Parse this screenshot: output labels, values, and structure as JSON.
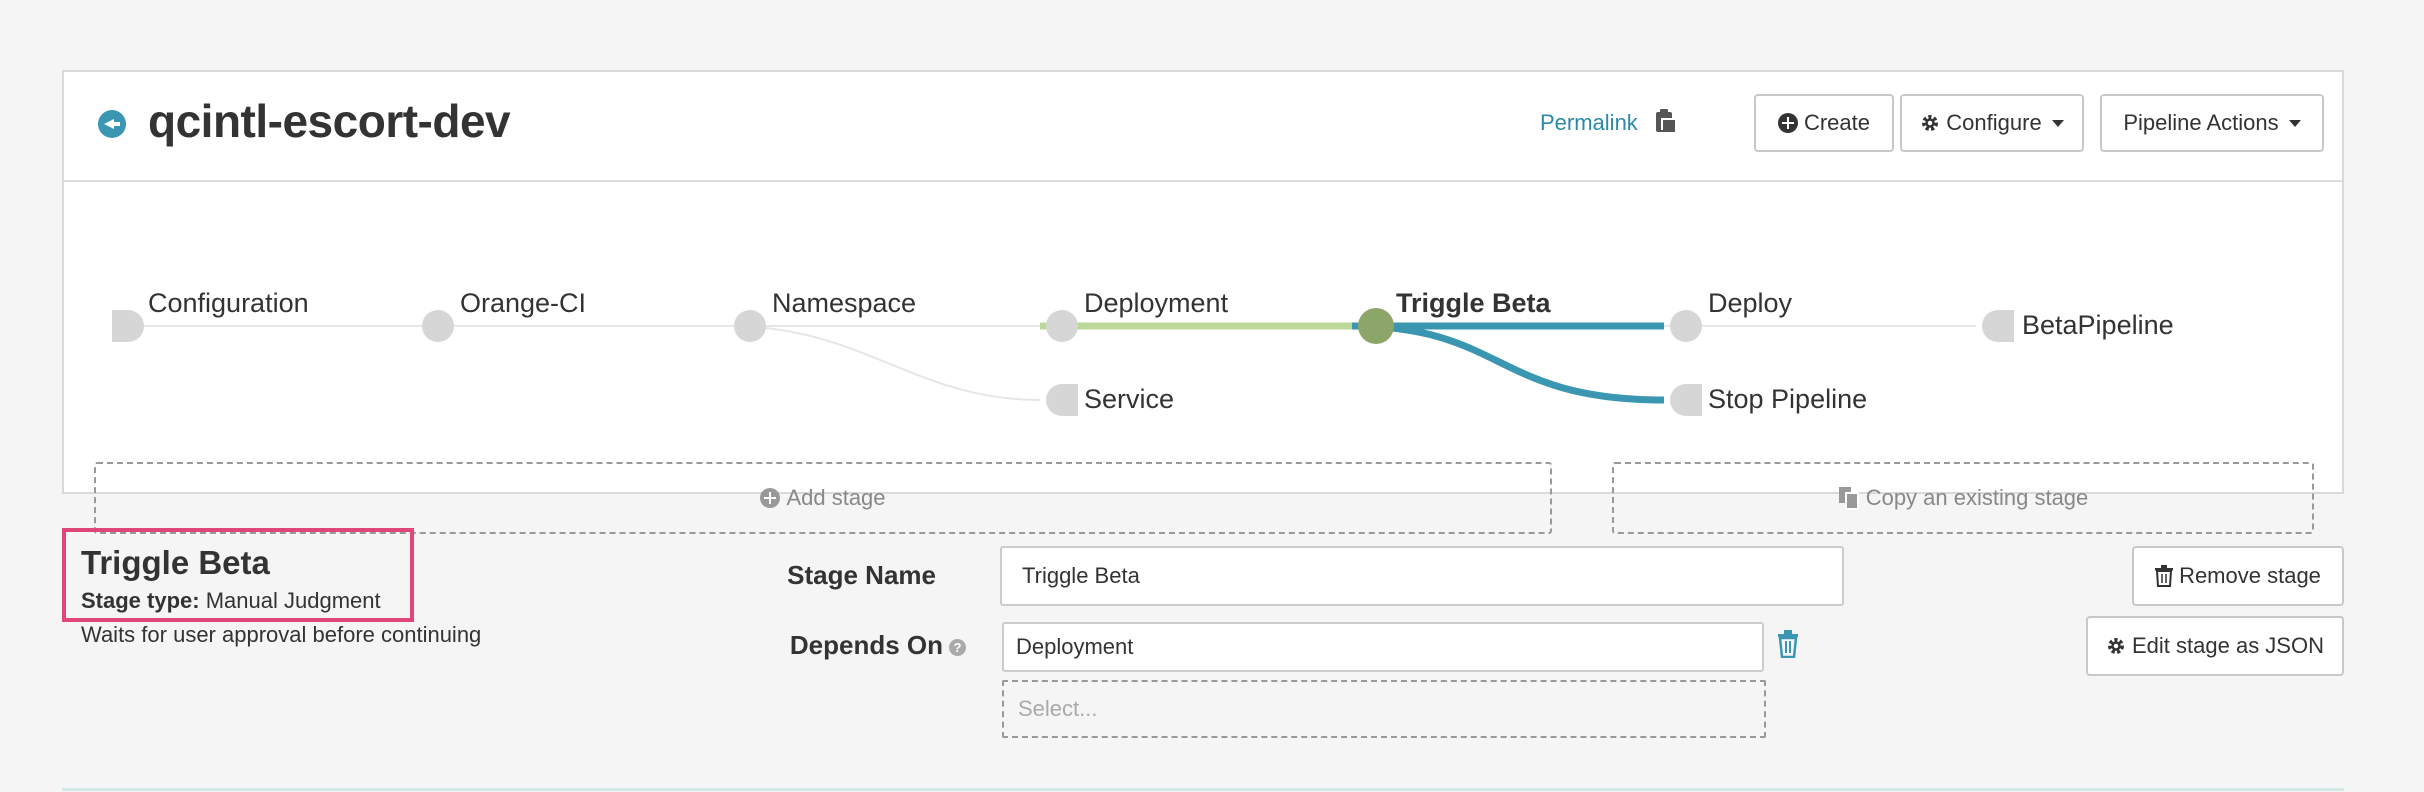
{
  "header": {
    "pipeline_name": "qcintl-escort-dev",
    "permalink": "Permalink",
    "create_label": "Create",
    "configure_label": "Configure",
    "pipeline_actions_label": "Pipeline Actions"
  },
  "graph": {
    "nodes": [
      {
        "label": "Configuration"
      },
      {
        "label": "Orange-CI"
      },
      {
        "label": "Namespace"
      },
      {
        "label": "Deployment"
      },
      {
        "label": "Service"
      },
      {
        "label": "Triggle Beta",
        "active": true
      },
      {
        "label": "Deploy"
      },
      {
        "label": "Stop Pipeline"
      },
      {
        "label": "BetaPipeline"
      }
    ],
    "add_stage_label": "Add stage",
    "copy_stage_label": "Copy an existing stage",
    "colors": {
      "active_node": "#8ca66a",
      "upstream_edge": "#bcd99a",
      "downstream_edge": "#3b97b1",
      "idle_node": "#d6d6d6"
    }
  },
  "stage": {
    "title": "Triggle Beta",
    "type_label": "Stage type:",
    "type_value": "Manual Judgment",
    "description": "Waits for user approval before continuing"
  },
  "form": {
    "stage_name_label": "Stage Name",
    "stage_name_value": "Triggle Beta",
    "depends_on_label": "Depends On",
    "depends_on_value": "Deployment",
    "select_placeholder": "Select...",
    "remove_stage_label": "Remove stage",
    "edit_json_label": "Edit stage as JSON"
  }
}
